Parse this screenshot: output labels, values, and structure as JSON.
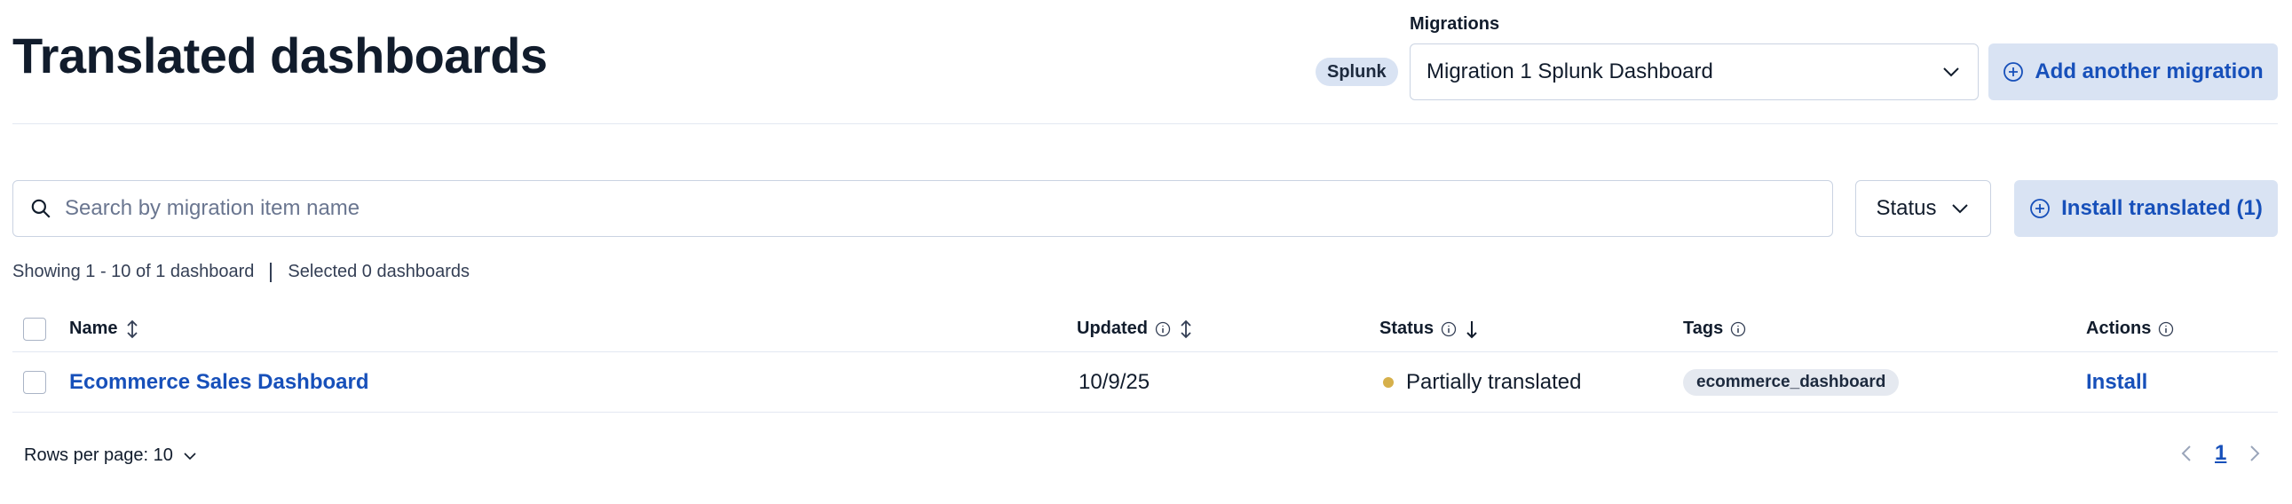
{
  "page": {
    "title": "Translated dashboards"
  },
  "header": {
    "source_badge": "Splunk",
    "migrations_label": "Migrations",
    "migration_selected": "Migration 1 Splunk Dashboard",
    "add_migration_label": "Add another migration"
  },
  "toolbar": {
    "search_placeholder": "Search by migration item name",
    "status_label": "Status",
    "install_label": "Install translated (1)"
  },
  "summary": {
    "showing": "Showing 1 - 10 of 1 dashboard",
    "selected": "Selected 0 dashboards"
  },
  "table": {
    "columns": {
      "name": "Name",
      "updated": "Updated",
      "status": "Status",
      "tags": "Tags",
      "actions": "Actions"
    },
    "rows": [
      {
        "name": "Ecommerce Sales Dashboard",
        "updated": "10/9/25",
        "status": "Partially translated",
        "tag": "ecommerce_dashboard",
        "action": "Install"
      }
    ]
  },
  "pagination": {
    "rows_per_page": "Rows per page: 10",
    "current_page": "1"
  },
  "colors": {
    "accent": "#1750ba",
    "accent_bg": "#d9e3f3",
    "status_partial": "#d6b04b"
  }
}
